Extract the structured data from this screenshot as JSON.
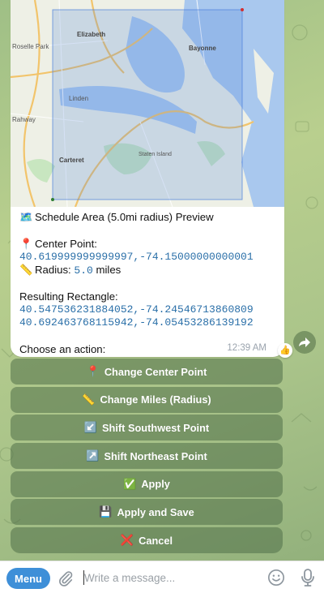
{
  "message": {
    "title_emoji": "🗺️",
    "title": "Schedule Area (5.0mi radius) Preview",
    "center_label_emoji": "📍",
    "center_label": "Center Point:",
    "center_coords": "40.619999999999997,-74.15000000000001",
    "radius_emoji": "📏",
    "radius_label": "Radius:",
    "radius_value": "5.0",
    "radius_unit": "miles",
    "rect_label": "Resulting Rectangle:",
    "rect_sw": "40.547536231884052,-74.24546713860809",
    "rect_ne": "40.692463768115942,-74.05453286139192",
    "prompt": "Choose an action:",
    "time": "12:39 AM",
    "reaction": "👍"
  },
  "map": {
    "labels": [
      "Roselle Park",
      "Elizabeth",
      "Bayonne",
      "Rahway",
      "Carteret",
      "Staten Island",
      "Linden"
    ],
    "water_color": "#a9c8ee",
    "land_color": "#eef0e6",
    "park_color": "#c8e6c0",
    "overlay_color": "#4a7fdc"
  },
  "keyboard": [
    {
      "icon": "📍",
      "label": "Change Center Point"
    },
    {
      "icon": "📏",
      "label": "Change Miles (Radius)"
    },
    {
      "icon": "↙️",
      "label": "Shift Southwest Point"
    },
    {
      "icon": "↗️",
      "label": "Shift Northeast Point"
    },
    {
      "icon": "✅",
      "label": "Apply"
    },
    {
      "icon": "💾",
      "label": "Apply and Save"
    },
    {
      "icon": "❌",
      "label": "Cancel"
    }
  ],
  "input": {
    "menu_label": "Menu",
    "placeholder": "Write a message..."
  }
}
